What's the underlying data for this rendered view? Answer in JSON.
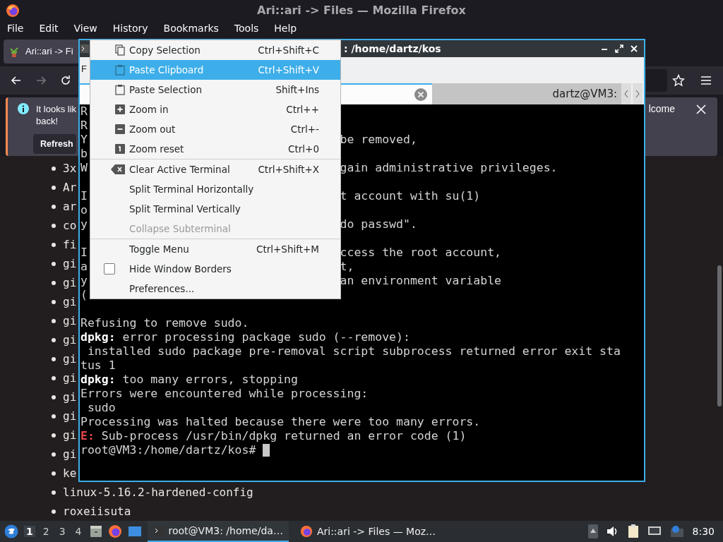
{
  "firefox": {
    "title": "Ari::ari -> Files — Mozilla Firefox",
    "menu": [
      "File",
      "Edit",
      "View",
      "History",
      "Bookmarks",
      "Tools",
      "Help"
    ],
    "tab": {
      "label": "Ari::ari -> Fi"
    },
    "notification": {
      "text": "It looks lik",
      "text_2": "back!",
      "text_right": "lcome",
      "button": "Refresh"
    },
    "page_list": [
      "3x",
      "Ar",
      "ar",
      "co",
      "fi",
      "gi",
      "gi",
      "gi",
      "gi",
      "gi",
      "gi",
      "gi",
      "gi",
      "gi",
      "gi",
      "gi",
      "ke",
      "linux-5.16.2-hardened-config",
      "roxeiisuta"
    ]
  },
  "terminal": {
    "title": ": /home/dartz/kos",
    "menu": [
      "F"
    ],
    "tabs": [
      {
        "selected": true
      },
      {
        "label": "dartz@VM3:",
        "selected": false
      }
    ],
    "lines": [
      {
        "kind": "split",
        "left": "R"
      },
      {
        "kind": "split",
        "left": "R"
      },
      {
        "kind": "split",
        "left": "Y",
        "right": "be removed,"
      },
      {
        "kind": "split",
        "left": "b"
      },
      {
        "kind": "split",
        "left": "W",
        "right": "gain administrative privileges."
      },
      {
        "kind": "blank"
      },
      {
        "kind": "split",
        "left": "I",
        "right": "t account with su(1)"
      },
      {
        "kind": "split",
        "left": "o"
      },
      {
        "kind": "split",
        "left": "y",
        "right": "do passwd\"."
      },
      {
        "kind": "blank"
      },
      {
        "kind": "split",
        "left": "I",
        "right": "ccess the root account,"
      },
      {
        "kind": "split",
        "left": "a",
        "right": "t,"
      },
      {
        "kind": "split",
        "left": "y",
        "right": "an environment variable"
      },
      {
        "kind": "split",
        "left": "("
      },
      {
        "kind": "blank"
      },
      {
        "kind": "full",
        "text": "Refusing to remove sudo."
      },
      {
        "kind": "full",
        "bold_tag": "dpkg:",
        "text": " error processing package sudo (--remove):"
      },
      {
        "kind": "full",
        "text": " installed sudo package pre-removal script subprocess returned error exit sta"
      },
      {
        "kind": "full",
        "text": "tus 1"
      },
      {
        "kind": "full",
        "bold_tag": "dpkg:",
        "text": " too many errors, stopping"
      },
      {
        "kind": "full",
        "text": "Errors were encountered while processing:"
      },
      {
        "kind": "full",
        "text": " sudo"
      },
      {
        "kind": "full",
        "text": "Processing was halted because there were too many errors."
      },
      {
        "kind": "full",
        "error_tag": "E:",
        "text": " Sub-process /usr/bin/dpkg returned an error code (1)"
      },
      {
        "kind": "prompt",
        "text": "root@VM3:/home/dartz/kos# "
      }
    ]
  },
  "context_menu": [
    {
      "kind": "item",
      "label": "Copy Selection",
      "shortcut": "Ctrl+Shift+C",
      "selected": false,
      "disabled": false
    },
    {
      "kind": "item",
      "label": "Paste Clipboard",
      "shortcut": "Ctrl+Shift+V",
      "selected": true,
      "disabled": false
    },
    {
      "kind": "item",
      "label": "Paste Selection",
      "shortcut": "Shift+Ins",
      "selected": false,
      "disabled": false
    },
    {
      "kind": "item",
      "label": "Zoom in",
      "shortcut": "Ctrl++",
      "selected": false,
      "disabled": false
    },
    {
      "kind": "item",
      "label": "Zoom out",
      "shortcut": "Ctrl+-",
      "selected": false,
      "disabled": false
    },
    {
      "kind": "item",
      "label": "Zoom reset",
      "shortcut": "Ctrl+0",
      "selected": false,
      "disabled": false
    },
    {
      "kind": "separator"
    },
    {
      "kind": "item",
      "label": "Clear Active Terminal",
      "shortcut": "Ctrl+Shift+X",
      "selected": false,
      "disabled": false
    },
    {
      "kind": "item",
      "label": "Split Terminal Horizontally",
      "selected": false,
      "disabled": false
    },
    {
      "kind": "item",
      "label": "Split Terminal Vertically",
      "selected": false,
      "disabled": false
    },
    {
      "kind": "item",
      "label": "Collapse Subterminal",
      "selected": false,
      "disabled": true
    },
    {
      "kind": "separator"
    },
    {
      "kind": "item",
      "label": "Toggle Menu",
      "shortcut": "Ctrl+Shift+M",
      "selected": false,
      "disabled": false
    },
    {
      "kind": "checkbox",
      "label": "Hide Window Borders",
      "checked": false,
      "selected": false,
      "disabled": false
    },
    {
      "kind": "item",
      "label": "Preferences...",
      "selected": false,
      "disabled": false
    }
  ],
  "taskbar": {
    "workspaces": [
      {
        "label": "1",
        "selected": true
      },
      {
        "label": "2",
        "selected": false
      },
      {
        "label": "3",
        "selected": false
      },
      {
        "label": "4",
        "selected": false
      }
    ],
    "tasks": [
      {
        "label": "root@VM3: /home/da…",
        "selected": true
      },
      {
        "label": "Ari::ari -> Files — Moz…",
        "selected": false
      }
    ],
    "clock": "8:30"
  }
}
